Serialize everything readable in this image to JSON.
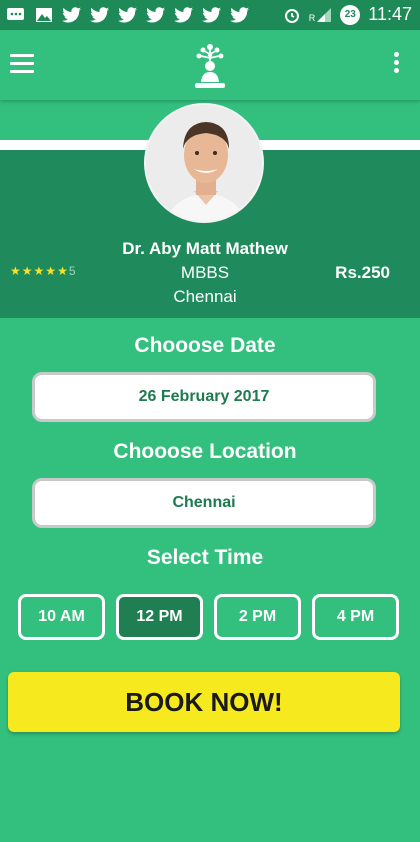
{
  "status_bar": {
    "time": "11:47",
    "notif_count": "23",
    "signal_label": "R",
    "icons": [
      "message-icon",
      "image-icon",
      "twitter-icon",
      "twitter-icon",
      "twitter-icon",
      "twitter-icon",
      "twitter-icon",
      "twitter-icon",
      "twitter-icon"
    ]
  },
  "app_bar": {
    "menu_icon": "hamburger-menu-icon",
    "logo_icon": "tree-meditation-logo-icon",
    "more_icon": "more-vertical-icon"
  },
  "doctor": {
    "name": "Dr. Aby Matt Mathew",
    "degree": "MBBS",
    "city": "Chennai",
    "fee": "Rs.250",
    "rating_stars": 4.5,
    "rating_max": 5,
    "rating_suffix": "5"
  },
  "booking": {
    "date_title": "Chooose Date",
    "date_value": "26 February 2017",
    "location_title": "Chooose Location",
    "location_value": "Chennai",
    "time_title": "Select Time",
    "times": [
      "10 AM",
      "12 PM",
      "2 PM",
      "4 PM"
    ],
    "selected_time": "12 PM",
    "book_label": "BOOK NOW!"
  },
  "colors": {
    "primary": "#33bf7e",
    "dark": "#1f8a5b",
    "status_bar": "#1e8a57",
    "accent": "#f6ea1e"
  }
}
